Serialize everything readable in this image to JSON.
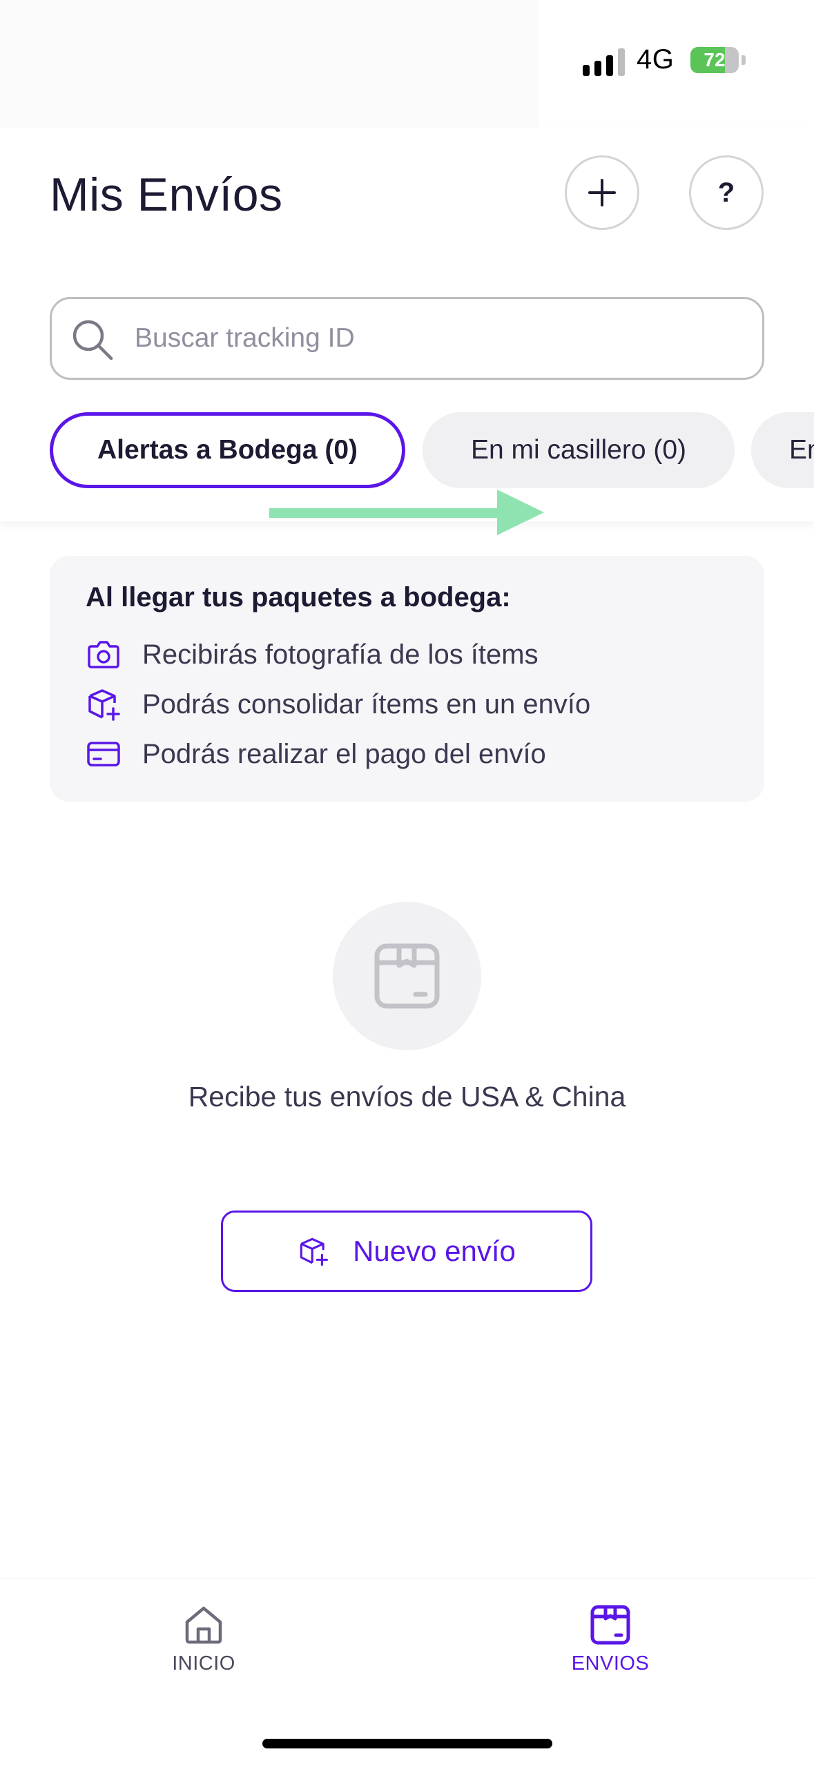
{
  "status_bar": {
    "network": "4G",
    "battery": "72",
    "battery_level_percent": 72
  },
  "header": {
    "title": "Mis Envíos",
    "add_icon": "plus-icon",
    "help_label": "?"
  },
  "search": {
    "placeholder": "Buscar tracking ID",
    "value": ""
  },
  "filters": [
    {
      "label": "Alertas a Bodega (0)",
      "active": true
    },
    {
      "label": "En mi casillero (0)",
      "active": false
    },
    {
      "label": "En",
      "active": false
    }
  ],
  "info_card": {
    "title": "Al llegar tus paquetes a bodega:",
    "items": [
      {
        "icon": "camera-icon",
        "label": "Recibirás fotografía de los ítems"
      },
      {
        "icon": "box-plus-icon",
        "label": "Podrás consolidar ítems en un envío"
      },
      {
        "icon": "credit-card-icon",
        "label": "Podrás realizar el pago del envío"
      }
    ]
  },
  "empty_state": {
    "icon": "package-icon",
    "text": "Recibe tus envíos de USA & China"
  },
  "new_shipment": {
    "icon": "box-plus-icon",
    "label": "Nuevo envío"
  },
  "bottom_nav": {
    "items": [
      {
        "icon": "home-icon",
        "label": "INICIO",
        "active": false
      },
      {
        "icon": "package-icon",
        "label": "ENVIOS",
        "active": true
      }
    ]
  },
  "colors": {
    "accent": "#5a16e8",
    "text": "#1c1b33",
    "battery": "#5bc458",
    "arrow": "#8fe3b0"
  }
}
